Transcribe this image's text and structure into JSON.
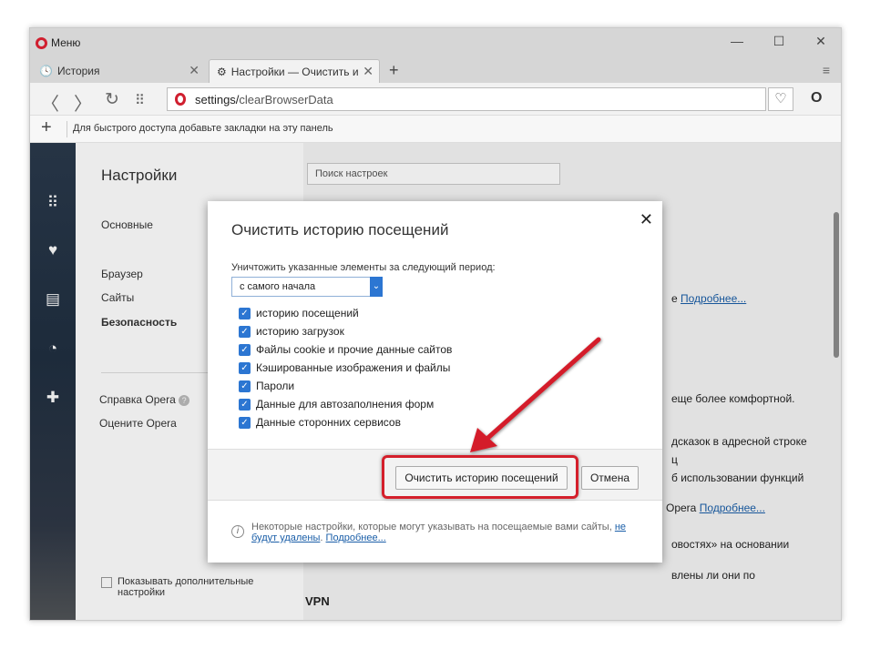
{
  "window": {
    "menu_label": "Меню",
    "minimize": "—",
    "maximize": "☐",
    "close": "✕"
  },
  "tabs": [
    {
      "label": "История",
      "close": "✕"
    },
    {
      "label": "Настройки — Очистить и",
      "close": "✕"
    }
  ],
  "new_tab": "+",
  "tab_menu": "≡",
  "address": {
    "url_prefix": "settings/",
    "url_path": "clearBrowserData"
  },
  "bookmarks": {
    "hint": "Для быстрого доступа добавьте закладки на эту панель"
  },
  "sidebar": {
    "title": "Настройки",
    "items": [
      "Основные",
      "Браузер",
      "Сайты",
      "Безопасность"
    ],
    "links": [
      "Справка Opera",
      "Оцените Opera"
    ],
    "advanced_checkbox": "Показывать дополнительные настройки"
  },
  "main": {
    "search_placeholder": "Поиск настроек",
    "bg_lines": [
      {
        "text": "е ",
        "link": "Подробнее..."
      },
      {
        "text": "еще более комфортной.",
        "link": ""
      },
      {
        "text": "дсказок в адресной строке",
        "link": ""
      },
      {
        "text": "ц",
        "link": ""
      },
      {
        "text": "б использовании функций",
        "link": ""
      },
      {
        "text": "Opera ",
        "link": "Подробнее..."
      },
      {
        "text": "овостях» на основании",
        "link": ""
      },
      {
        "text": "влены ли они по",
        "link": ""
      }
    ],
    "vpn_heading": "VPN"
  },
  "dialog": {
    "title": "Очистить историю посещений",
    "close": "✕",
    "period_label": "Уничтожить указанные элементы за следующий период:",
    "period_value": "с самого начала",
    "checkboxes": [
      "историю посещений",
      "историю загрузок",
      "Файлы cookie и прочие данные сайтов",
      "Кэшированные изображения и файлы",
      "Пароли",
      "Данные для автозаполнения форм",
      "Данные сторонних сервисов"
    ],
    "clear_button": "Очистить историю посещений",
    "cancel_button": "Отмена",
    "info_text": "Некоторые настройки, которые могут указывать на посещаемые вами сайты, ",
    "info_link1": "не будут удалены",
    "info_sep": ". ",
    "info_link2": "Подробнее..."
  },
  "colors": {
    "accent": "#2c76d2",
    "highlight": "#d41f2b",
    "opera_red": "#d01f2f"
  }
}
